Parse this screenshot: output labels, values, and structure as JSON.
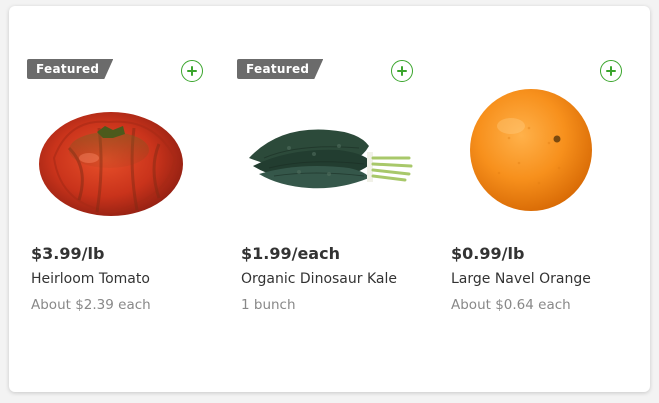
{
  "products": [
    {
      "badge": "Featured",
      "price": "$3.99/lb",
      "name": "Heirloom Tomato",
      "subtext": "About $2.39 each",
      "image_icon": "tomato-image"
    },
    {
      "badge": "Featured",
      "price": "$1.99/each",
      "name": "Organic Dinosaur Kale",
      "subtext": "1 bunch",
      "image_icon": "kale-image"
    },
    {
      "price": "$0.99/lb",
      "name": "Large Navel Orange",
      "subtext": "About $0.64 each",
      "image_icon": "orange-image"
    }
  ],
  "colors": {
    "accent": "#3aa52c",
    "badge_bg": "#6b6b6b",
    "text": "#333333",
    "subtext": "#888888"
  }
}
